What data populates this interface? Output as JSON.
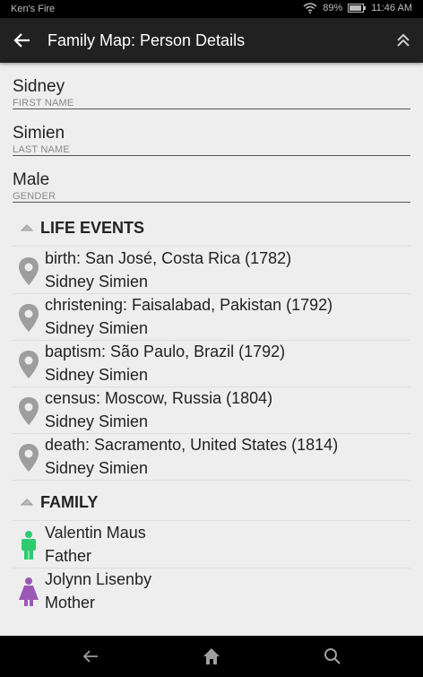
{
  "status_bar": {
    "device_name": "Ken's Fire",
    "battery": "89%",
    "time": "11:46 AM"
  },
  "app_bar": {
    "title": "Family Map: Person Details"
  },
  "person": {
    "first_name": {
      "value": "Sidney",
      "label": "FIRST NAME"
    },
    "last_name": {
      "value": "Simien",
      "label": "LAST NAME"
    },
    "gender": {
      "value": "Male",
      "label": "GENDER"
    }
  },
  "life_events": {
    "header": "LIFE EVENTS",
    "items": [
      {
        "event": "birth: San José, Costa Rica (1782)",
        "person": "Sidney Simien"
      },
      {
        "event": "christening: Faisalabad, Pakistan (1792)",
        "person": "Sidney Simien"
      },
      {
        "event": "baptism: São Paulo, Brazil (1792)",
        "person": "Sidney Simien"
      },
      {
        "event": "census: Moscow, Russia (1804)",
        "person": "Sidney Simien"
      },
      {
        "event": "death: Sacramento, United States (1814)",
        "person": "Sidney Simien"
      }
    ]
  },
  "family": {
    "header": "FAMILY",
    "items": [
      {
        "name": "Valentin Maus",
        "relation": "Father",
        "icon": "male-icon",
        "color": "#2ecc71"
      },
      {
        "name": "Jolynn Lisenby",
        "relation": "Mother",
        "icon": "female-icon",
        "color": "#9b59b6"
      }
    ]
  },
  "colors": {
    "pin": "#9e9e9e",
    "male": "#2ecc71",
    "female": "#9b59b6"
  }
}
